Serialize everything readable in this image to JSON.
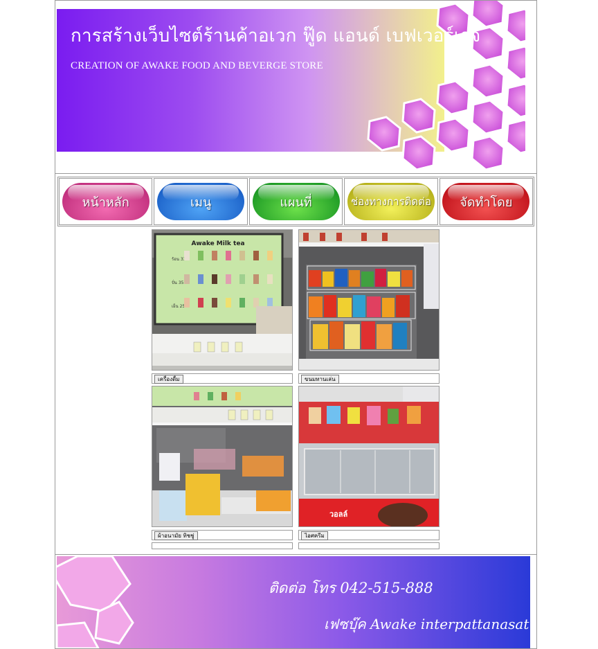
{
  "header": {
    "title": "การสร้างเว็บไซต์ร้านค้าอเวก ฟู๊ด แอนด์ เบฟเวอร์เรจ",
    "subtitle": "CREATION OF AWAKE FOOD AND BEVERGE STORE"
  },
  "nav": {
    "items": [
      {
        "label": "หน้าหลัก",
        "color": "#d9418f"
      },
      {
        "label": "เมนู",
        "color": "#2b74d6"
      },
      {
        "label": "แผนที่",
        "color": "#2caa2e"
      },
      {
        "label": "ช่องทางการติดต่อ",
        "color": "#d2cd2a"
      },
      {
        "label": "จัดทำโดย",
        "color": "#d81e26"
      }
    ]
  },
  "gallery": {
    "items": [
      {
        "caption": "เครื่องดื่ม",
        "image": "drinks-menu-board-photo"
      },
      {
        "caption": "ขนมทานเล่น",
        "image": "snack-rack-photo"
      },
      {
        "caption": "ผ้าอนามัย ทิชชู่",
        "image": "shelf-products-photo"
      },
      {
        "caption": "ไอศครีม",
        "image": "ice-cream-freezer-photo"
      }
    ],
    "menu_board": {
      "title": "Awake Milk tea",
      "price_hot": "ร้อน 33.-",
      "price_blend": "ปั่น 35.-",
      "price_cold": "เย็น 25.-"
    },
    "freezer_brand": "วอลล์"
  },
  "footer": {
    "phone": "ติดต่อ โทร  042-515-888",
    "facebook": "เฟซบุ๊ค  Awake interpattanasat."
  },
  "colors": {
    "banner_start": "#7a1cf0",
    "banner_end": "#f2f08c",
    "hex_fill": "#e06ad8",
    "footer_start": "#e89ad8",
    "footer_end": "#2a3ad8"
  }
}
